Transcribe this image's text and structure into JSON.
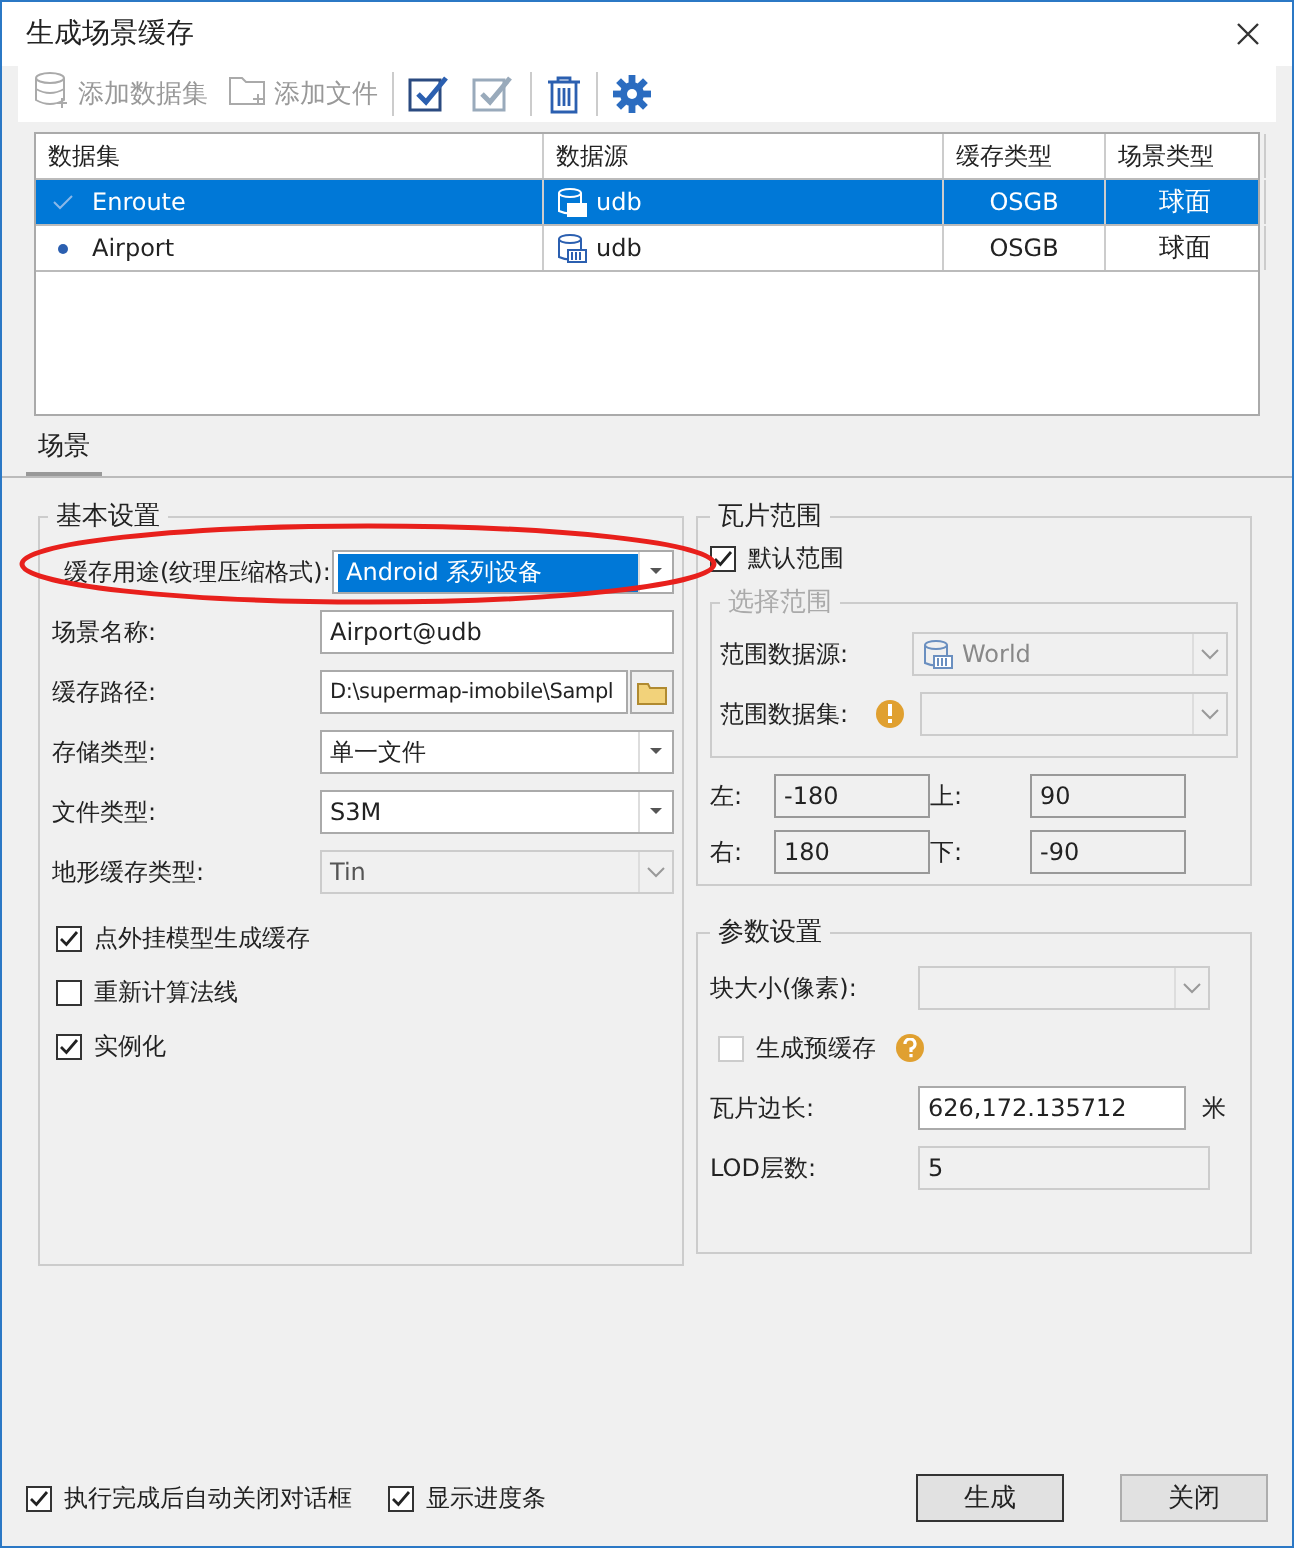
{
  "window": {
    "title": "生成场景缓存"
  },
  "toolbar": [
    {
      "kind": "dataset",
      "label": "添加数据集",
      "disabled": true
    },
    {
      "kind": "file",
      "label": "添加文件",
      "disabled": true
    },
    {
      "kind": "select-all",
      "disabled": false
    },
    {
      "kind": "select-invert",
      "disabled": true
    },
    {
      "kind": "delete",
      "disabled": false
    },
    {
      "kind": "settings",
      "disabled": false
    }
  ],
  "table": {
    "columns": [
      "数据集",
      "数据源",
      "缓存类型",
      "场景类型"
    ],
    "rows": [
      {
        "kind": "check",
        "dataset": "Enroute",
        "datasource": "udb",
        "cache_type": "OSGB",
        "scene_type": "球面",
        "selected": true
      },
      {
        "kind": "dot",
        "dataset": "Airport",
        "datasource": "udb",
        "cache_type": "OSGB",
        "scene_type": "球面",
        "selected": false
      }
    ]
  },
  "tabs": [
    {
      "label": "场景",
      "selected": true
    }
  ],
  "basic_settings": {
    "title": "基本设置",
    "fields": [
      {
        "kind": "combo",
        "label": "缓存用途(纹理压缩格式):",
        "value": "Android 系列设备",
        "highlighted": true,
        "disabled": false
      },
      {
        "kind": "text",
        "label": "场景名称:",
        "value": "Airport@udb",
        "highlighted": false,
        "disabled": false
      },
      {
        "kind": "path",
        "label": "缓存路径:",
        "value": "D:\\supermap-imobile\\Sampl",
        "highlighted": false,
        "disabled": false
      },
      {
        "kind": "combo",
        "label": "存储类型:",
        "value": "单一文件",
        "highlighted": false,
        "disabled": false
      },
      {
        "kind": "combo",
        "label": "文件类型:",
        "value": "S3M",
        "highlighted": false,
        "disabled": false
      },
      {
        "kind": "combo",
        "label": "地形缓存类型:",
        "value": "Tin",
        "highlighted": false,
        "disabled": true
      }
    ],
    "checkboxes": [
      {
        "label": "点外挂模型生成缓存",
        "checked": true
      },
      {
        "label": "重新计算法线",
        "checked": false
      },
      {
        "label": "实例化",
        "checked": true
      }
    ]
  },
  "tile_range": {
    "title": "瓦片范围",
    "default_range": {
      "label": "默认范围",
      "checked": true
    },
    "select_range": {
      "title": "选择范围",
      "disabled": true,
      "datasource": {
        "label": "范围数据源:",
        "value": "World"
      },
      "dataset": {
        "label": "范围数据集:"
      }
    },
    "bounds": [
      {
        "label": "左:",
        "value": "-180"
      },
      {
        "label": "上:",
        "value": "90"
      },
      {
        "label": "右:",
        "value": "180"
      },
      {
        "label": "下:",
        "value": "-90"
      }
    ]
  },
  "parameters": {
    "title": "参数设置",
    "block_size": {
      "label": "块大小(像素):"
    },
    "pre_cache": {
      "label": "生成预缓存",
      "checked": false,
      "disabled": true
    },
    "tile_length": {
      "label": "瓦片边长:",
      "value": "626,172.135712",
      "unit": "米"
    },
    "lod": {
      "label": "LOD层数:",
      "value": "5"
    }
  },
  "footer": {
    "checkboxes": [
      {
        "label": "执行完成后自动关闭对话框",
        "checked": true
      },
      {
        "label": "显示进度条",
        "checked": true
      }
    ],
    "buttons": [
      {
        "label": "生成",
        "default": true
      },
      {
        "label": "关闭",
        "default": false
      }
    ]
  }
}
